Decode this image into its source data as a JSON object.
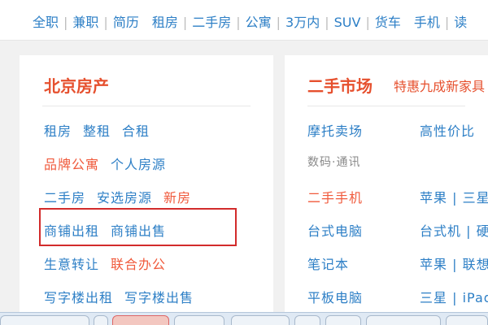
{
  "topnav": {
    "groups": [
      [
        "全职",
        "兼职",
        "简历"
      ],
      [
        "租房",
        "二手房",
        "公寓",
        "3万内",
        "SUV",
        "货车"
      ],
      [
        "手机",
        "读"
      ]
    ]
  },
  "left_panel": {
    "title": "北京房产",
    "rows": [
      [
        {
          "text": "租房",
          "color": "blue"
        },
        {
          "text": "整租",
          "color": "blue"
        },
        {
          "text": "合租",
          "color": "blue"
        }
      ],
      [
        {
          "text": "品牌公寓",
          "color": "orange"
        },
        {
          "text": "个人房源",
          "color": "blue"
        }
      ],
      [
        {
          "text": "二手房",
          "color": "blue"
        },
        {
          "text": "安选房源",
          "color": "blue"
        },
        {
          "text": "新房",
          "color": "orange"
        }
      ],
      [
        {
          "text": "商铺出租",
          "color": "blue"
        },
        {
          "text": "商铺出售",
          "color": "blue"
        }
      ],
      [
        {
          "text": "生意转让",
          "color": "blue"
        },
        {
          "text": "联合办公",
          "color": "orange"
        }
      ],
      [
        {
          "text": "写字楼出租",
          "color": "blue"
        },
        {
          "text": "写字楼出售",
          "color": "blue"
        }
      ]
    ]
  },
  "right_panel": {
    "title": "二手市场",
    "subtitle": "特惠九成新家具",
    "rows": [
      [
        {
          "text": "摩托卖场",
          "color": "blue"
        },
        {
          "text": "高性价比",
          "color": "blue"
        }
      ],
      [
        {
          "text": "数码·通讯",
          "color": "gray"
        }
      ],
      [
        {
          "text": "二手手机",
          "color": "orange"
        },
        {
          "text": "苹果 | 三星",
          "color": "blue"
        }
      ],
      [
        {
          "text": "台式电脑",
          "color": "blue"
        },
        {
          "text": "台式机 | 硬",
          "color": "blue"
        }
      ],
      [
        {
          "text": "笔记本",
          "color": "blue"
        },
        {
          "text": "苹果 | 联想",
          "color": "blue"
        }
      ],
      [
        {
          "text": "平板电脑",
          "color": "blue"
        },
        {
          "text": "三星 | iPad",
          "color": "blue"
        }
      ]
    ]
  },
  "colors": {
    "link_blue": "#2d7fc6",
    "accent_orange": "#f05a3c",
    "title_orange": "#e6502e",
    "highlight_red": "#d22b2b"
  }
}
